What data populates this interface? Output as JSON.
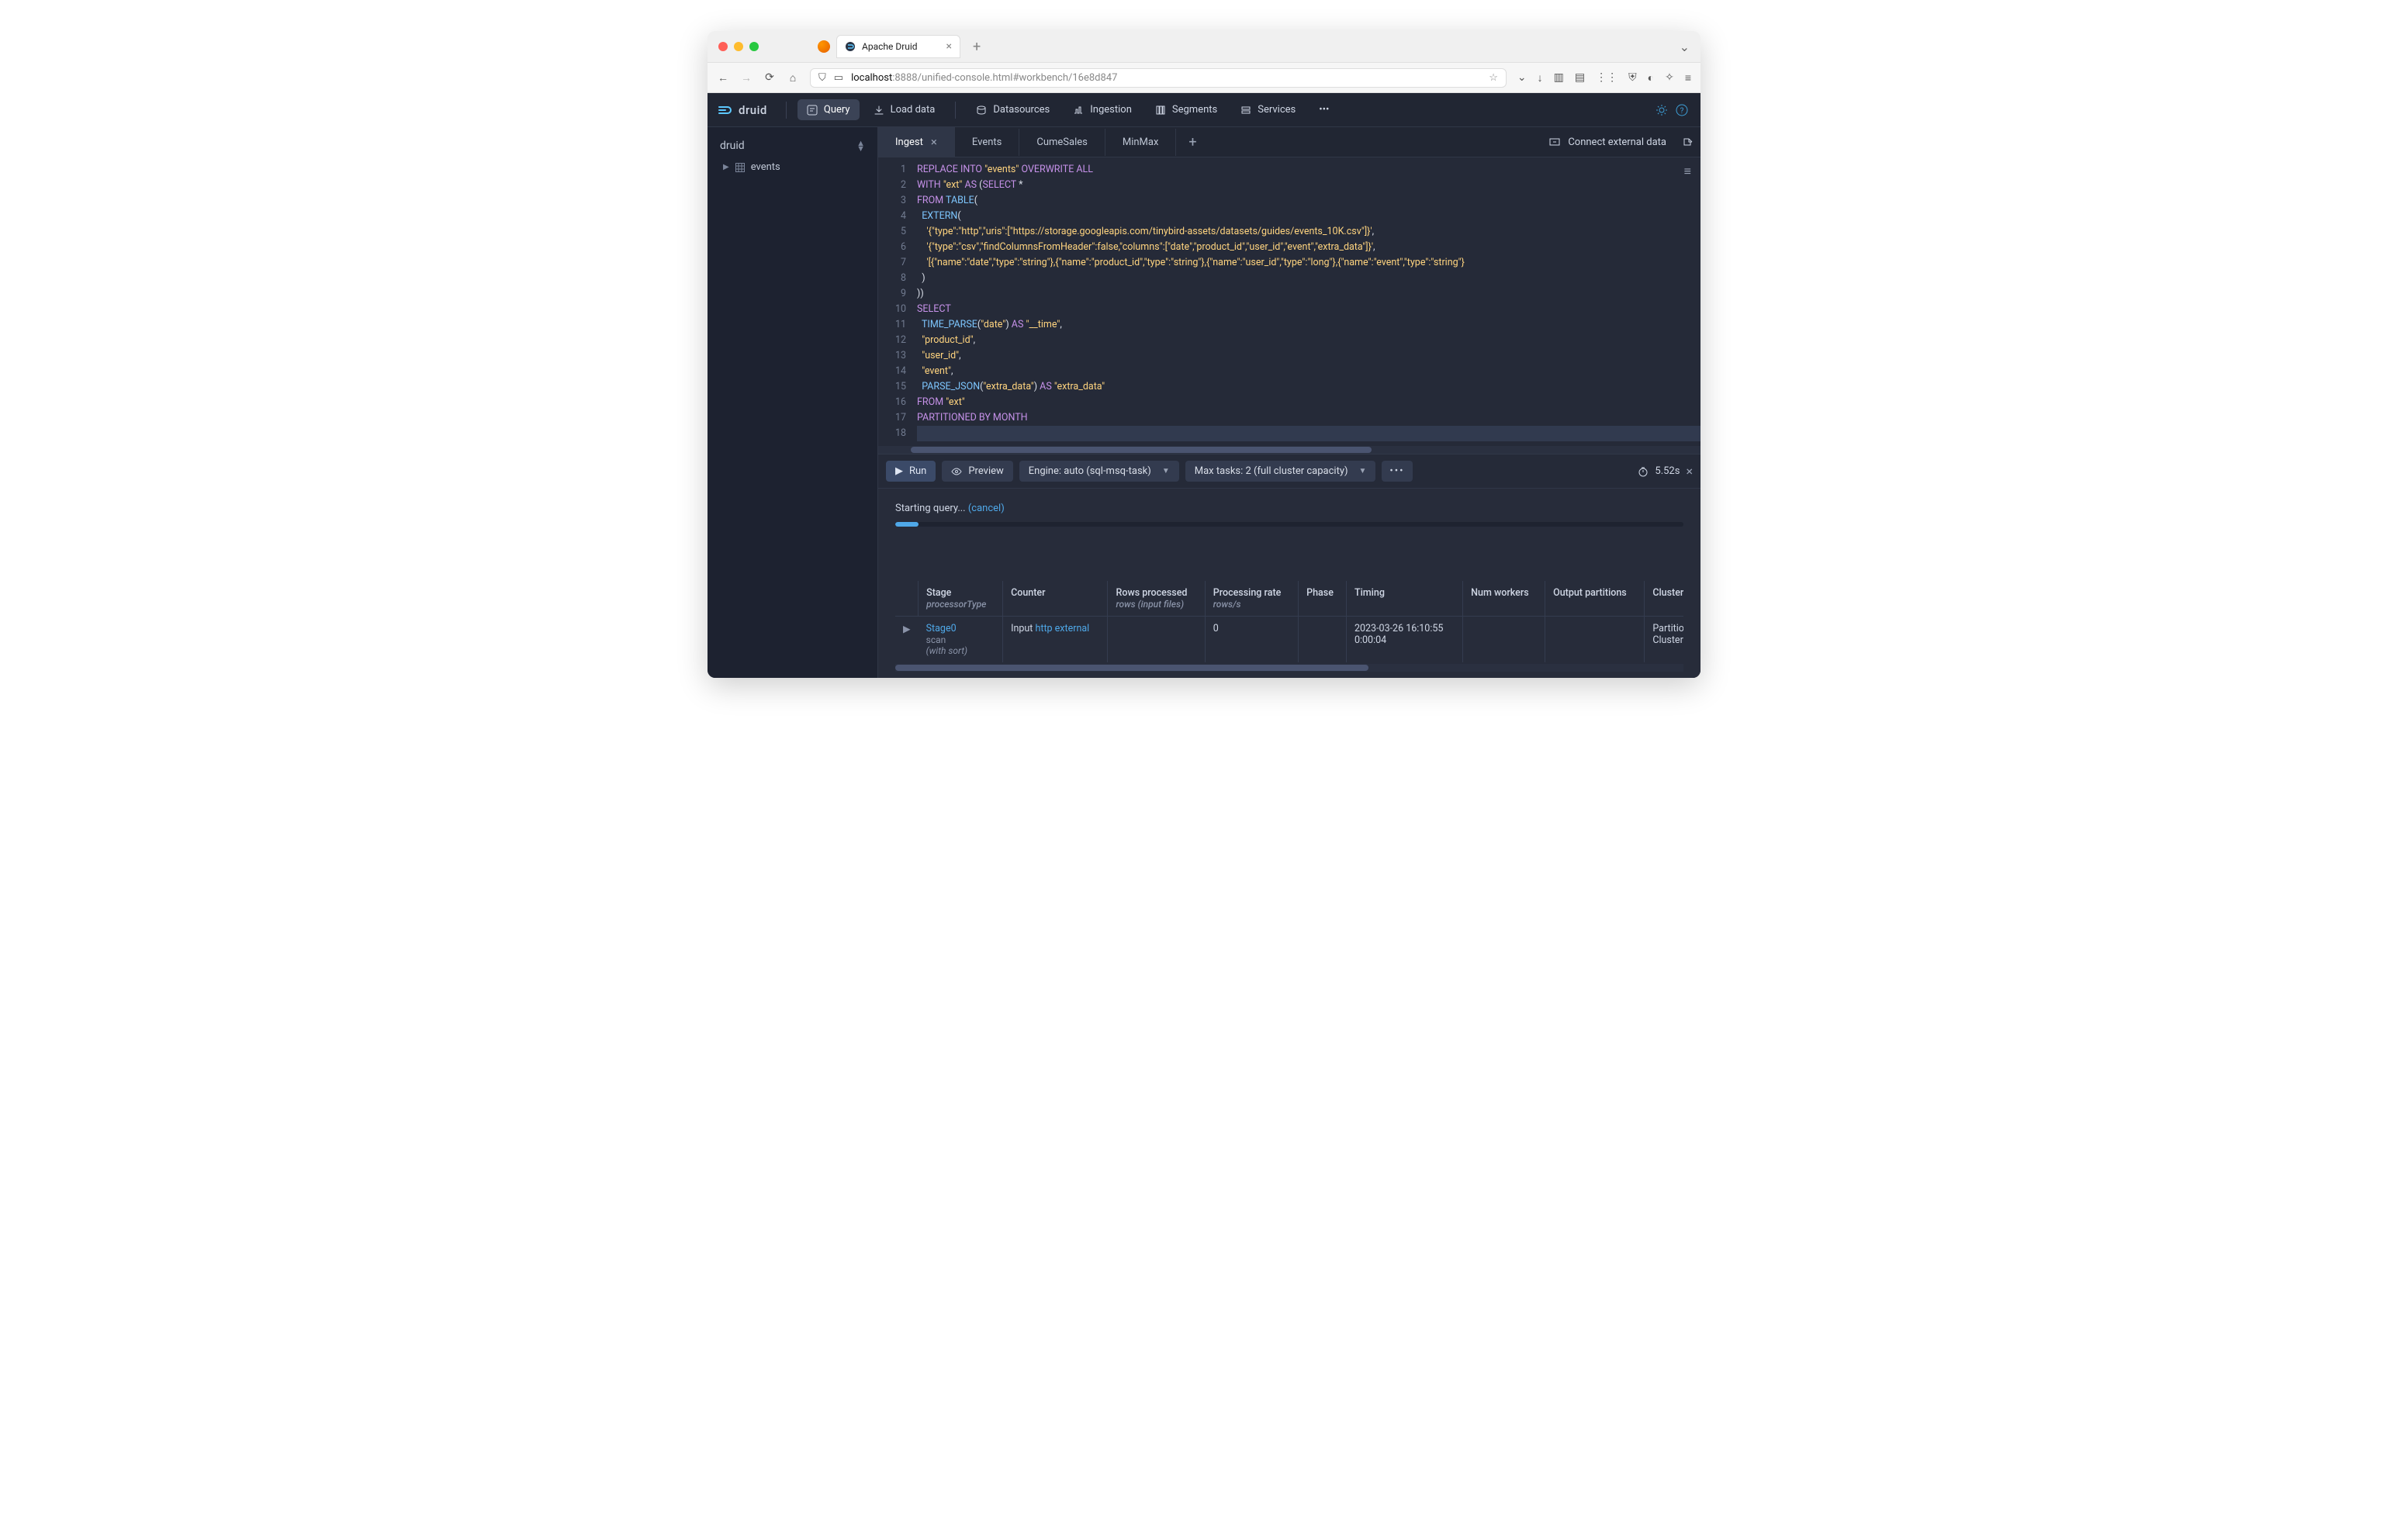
{
  "browser": {
    "tab_title": "Apache Druid",
    "url_host": "localhost",
    "url_rest": ":8888/unified-console.html#workbench/16e8d847"
  },
  "nav": {
    "logo": "druid",
    "items": [
      "Query",
      "Load data",
      "Datasources",
      "Ingestion",
      "Segments",
      "Services"
    ]
  },
  "sidebar": {
    "title": "druid",
    "items": [
      "events"
    ]
  },
  "tabs": {
    "items": [
      "Ingest",
      "Events",
      "CumeSales",
      "MinMax"
    ],
    "active": 0,
    "connect": "Connect external data"
  },
  "editor": {
    "line_count": 18,
    "lines_html": [
      "<span class='kw'>REPLACE</span> <span class='kw'>INTO</span> <span class='str'>\"events\"</span> <span class='kw'>OVERWRITE</span> <span class='kw'>ALL</span>",
      "<span class='kw'>WITH</span> <span class='str'>\"ext\"</span> <span class='kw'>AS</span> (<span class='kw'>SELECT</span> *",
      "<span class='kw'>FROM</span> <span class='fn'>TABLE</span>(",
      "  <span class='fn'>EXTERN</span>(",
      "    <span class='str'>'{\"type\":\"http\",\"uris\":[\"https://storage.googleapis.com/tinybird-assets/datasets/guides/events_10K.csv\"]}'</span>,",
      "    <span class='str'>'{\"type\":\"csv\",\"findColumnsFromHeader\":false,\"columns\":[\"date\",\"product_id\",\"user_id\",\"event\",\"extra_data\"]}'</span>,",
      "    <span class='str'>'[{\"name\":\"date\",\"type\":\"string\"},{\"name\":\"product_id\",\"type\":\"string\"},{\"name\":\"user_id\",\"type\":\"long\"},{\"name\":\"event\",\"type\":\"string\"}</span>",
      "  )",
      "))",
      "<span class='kw'>SELECT</span>",
      "  <span class='fn'>TIME_PARSE</span>(<span class='str'>\"date\"</span>) <span class='kw'>AS</span> <span class='str'>\"__time\"</span>,",
      "  <span class='str'>\"product_id\"</span>,",
      "  <span class='str'>\"user_id\"</span>,",
      "  <span class='str'>\"event\"</span>,",
      "  <span class='fn'>PARSE_JSON</span>(<span class='str'>\"extra_data\"</span>) <span class='kw'>AS</span> <span class='str'>\"extra_data\"</span>",
      "<span class='kw'>FROM</span> <span class='str'>\"ext\"</span>",
      "<span class='kw'>PARTITIONED BY MONTH</span>",
      ""
    ]
  },
  "runbar": {
    "run": "Run",
    "preview": "Preview",
    "engine": "Engine: auto (sql-msq-task)",
    "tasks": "Max tasks: 2 (full cluster capacity)",
    "elapsed": "5.52s"
  },
  "results": {
    "starting": "Starting query...",
    "cancel": "(cancel)",
    "progress_pct": 3,
    "columns": [
      {
        "h": "Stage",
        "s": "processorType"
      },
      {
        "h": "Counter",
        "s": ""
      },
      {
        "h": "Rows processed",
        "s": "rows   (input files)"
      },
      {
        "h": "Processing rate",
        "s": "rows/s"
      },
      {
        "h": "Phase",
        "s": ""
      },
      {
        "h": "Timing",
        "s": ""
      },
      {
        "h": "Num workers",
        "s": ""
      },
      {
        "h": "Output partitions",
        "s": ""
      },
      {
        "h": "Cluster by",
        "s": ""
      }
    ],
    "row": {
      "stage": "Stage0",
      "stage_sub1": "scan",
      "stage_sub2": "(with sort)",
      "counter_pre": "Input ",
      "counter_link": "http external",
      "rows": "",
      "rate": "0",
      "phase": "",
      "timing1": "2023-03-26 16:10:55",
      "timing2": "0:00:04",
      "workers": "",
      "partitions": "",
      "cluster1": "Partition by",
      "cluster2": "Cluster by:"
    }
  }
}
